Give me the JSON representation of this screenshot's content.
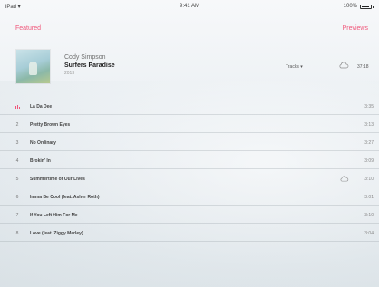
{
  "status_bar": {
    "carrier": "iPad ▾",
    "time": "9:41 AM",
    "battery": "100%"
  },
  "nav": {
    "back_label": "Featured",
    "right_label": "Previews"
  },
  "album": {
    "artist": "Cody Simpson",
    "title": "Surfers Paradise",
    "year": "2013",
    "info": "Tracks ▾",
    "duration": "37:18"
  },
  "tracks": [
    {
      "number": "",
      "title": "La Da Dee",
      "duration": "3:35",
      "playing": true,
      "cloud": false
    },
    {
      "number": "2",
      "title": "Pretty Brown Eyes",
      "duration": "3:13",
      "playing": false,
      "cloud": false
    },
    {
      "number": "3",
      "title": "No Ordinary",
      "duration": "3:27",
      "playing": false,
      "cloud": false
    },
    {
      "number": "4",
      "title": "Brokin' In",
      "duration": "3:09",
      "playing": false,
      "cloud": false
    },
    {
      "number": "5",
      "title": "Summertime of Our Lives",
      "duration": "3:10",
      "playing": false,
      "cloud": true
    },
    {
      "number": "6",
      "title": "Imma Be Cool (feat. Asher Roth)",
      "duration": "3:01",
      "playing": false,
      "cloud": false
    },
    {
      "number": "7",
      "title": "If You Left Him For Me",
      "duration": "3:10",
      "playing": false,
      "cloud": false
    },
    {
      "number": "8",
      "title": "Love (feat. Ziggy Marley)",
      "duration": "3:04",
      "playing": false,
      "cloud": false
    }
  ],
  "colors": {
    "accent": "#f0567a",
    "text_primary": "#222222",
    "text_secondary": "#888888"
  },
  "icons": {
    "cloud": "cloud-download-icon",
    "playing": "now-playing-icon",
    "battery": "battery-icon"
  }
}
